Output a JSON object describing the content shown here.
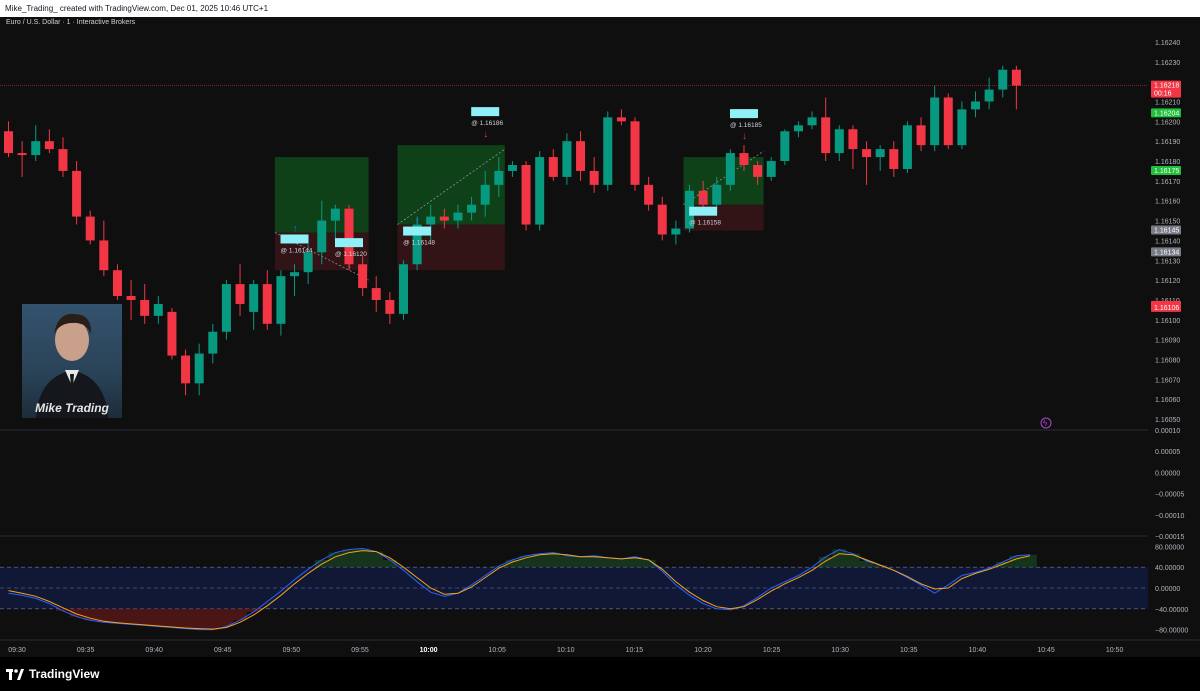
{
  "header": {
    "attribution": "Mike_Trading_ created with TradingView.com, Dec 01, 2025 10:46 UTC+1"
  },
  "symbol_title": "Euro / U.S. Dollar · 1 · Interactive Brokers",
  "overlay": {
    "caption": "Mike Trading"
  },
  "footer": {
    "brand": "TradingView"
  },
  "colors": {
    "up": "#089981",
    "down": "#f23645",
    "background": "#0f0f0f",
    "label_cyan": "#8ff0f8"
  },
  "chart_data": [
    {
      "type": "candlestick",
      "price_axis": {
        "ticks": [
          "1.16240",
          "1.16230",
          "1.16210",
          "1.16200",
          "1.16190",
          "1.16180",
          "1.16170",
          "1.16160",
          "1.16150",
          "1.16140",
          "1.16130",
          "1.16120",
          "1.16110",
          "1.16100",
          "1.16090",
          "1.16080",
          "1.16070",
          "1.16060",
          "1.16050"
        ],
        "badges": [
          {
            "text": "1.16218",
            "sub": "00:16",
            "color": "#f23645",
            "value": 1.16218
          },
          {
            "text": "1.16204",
            "color": "#1fbf3a",
            "value": 1.16204
          },
          {
            "text": "1.16175",
            "color": "#1fbf3a",
            "value": 1.16175
          },
          {
            "text": "1.16145",
            "color": "#787b86",
            "value": 1.16145
          },
          {
            "text": "1.16134",
            "color": "#787b86",
            "value": 1.16134
          },
          {
            "text": "1.16107",
            "color": "#f23645",
            "value": 1.16107
          },
          {
            "text": "1.16106",
            "color": "#f23645",
            "value": 1.16106
          }
        ]
      },
      "time_axis": [
        "09:30",
        "09:35",
        "09:40",
        "09:45",
        "09:50",
        "09:55",
        "10:00",
        "10:05",
        "10:10",
        "10:15",
        "10:20",
        "10:25",
        "10:30",
        "10:35",
        "10:40",
        "10:45",
        "10:50"
      ],
      "candles": [
        [
          1.16195,
          1.162,
          1.16182,
          1.16184
        ],
        [
          1.16184,
          1.1619,
          1.16172,
          1.16183
        ],
        [
          1.16183,
          1.16198,
          1.1618,
          1.1619
        ],
        [
          1.1619,
          1.16196,
          1.16184,
          1.16186
        ],
        [
          1.16186,
          1.16192,
          1.16172,
          1.16175
        ],
        [
          1.16175,
          1.1618,
          1.16148,
          1.16152
        ],
        [
          1.16152,
          1.16155,
          1.16138,
          1.1614
        ],
        [
          1.1614,
          1.1615,
          1.16122,
          1.16125
        ],
        [
          1.16125,
          1.16128,
          1.1611,
          1.16112
        ],
        [
          1.16112,
          1.1612,
          1.161,
          1.1611
        ],
        [
          1.1611,
          1.16118,
          1.16098,
          1.16102
        ],
        [
          1.16102,
          1.16112,
          1.16098,
          1.16108
        ],
        [
          1.16104,
          1.16106,
          1.1608,
          1.16082
        ],
        [
          1.16082,
          1.16085,
          1.16062,
          1.16068
        ],
        [
          1.16068,
          1.16088,
          1.16062,
          1.16083
        ],
        [
          1.16083,
          1.16098,
          1.16078,
          1.16094
        ],
        [
          1.16094,
          1.1612,
          1.1609,
          1.16118
        ],
        [
          1.16118,
          1.16128,
          1.16102,
          1.16108
        ],
        [
          1.16104,
          1.1612,
          1.16095,
          1.16118
        ],
        [
          1.16118,
          1.16125,
          1.16095,
          1.16098
        ],
        [
          1.16098,
          1.16125,
          1.16092,
          1.16122
        ],
        [
          1.16122,
          1.16128,
          1.16112,
          1.16124
        ],
        [
          1.16124,
          1.16138,
          1.16118,
          1.16134
        ],
        [
          1.16134,
          1.1616,
          1.16128,
          1.1615
        ],
        [
          1.1615,
          1.16158,
          1.1614,
          1.16156
        ],
        [
          1.16156,
          1.16158,
          1.16125,
          1.16128
        ],
        [
          1.16128,
          1.16132,
          1.16112,
          1.16116
        ],
        [
          1.16116,
          1.16122,
          1.16104,
          1.1611
        ],
        [
          1.1611,
          1.16114,
          1.16098,
          1.16103
        ],
        [
          1.16103,
          1.1613,
          1.161,
          1.16128
        ],
        [
          1.16128,
          1.16152,
          1.16125,
          1.16148
        ],
        [
          1.16148,
          1.16158,
          1.1614,
          1.16152
        ],
        [
          1.16152,
          1.16156,
          1.16146,
          1.1615
        ],
        [
          1.1615,
          1.16158,
          1.16146,
          1.16154
        ],
        [
          1.16154,
          1.16162,
          1.1615,
          1.16158
        ],
        [
          1.16158,
          1.16175,
          1.16152,
          1.16168
        ],
        [
          1.16168,
          1.16182,
          1.16162,
          1.16175
        ],
        [
          1.16175,
          1.1618,
          1.16172,
          1.16178
        ],
        [
          1.16178,
          1.1618,
          1.16145,
          1.16148
        ],
        [
          1.16148,
          1.16185,
          1.16145,
          1.16182
        ],
        [
          1.16182,
          1.16186,
          1.1617,
          1.16172
        ],
        [
          1.16172,
          1.16194,
          1.16168,
          1.1619
        ],
        [
          1.1619,
          1.16195,
          1.1617,
          1.16175
        ],
        [
          1.16175,
          1.16182,
          1.16164,
          1.16168
        ],
        [
          1.16168,
          1.16205,
          1.16165,
          1.16202
        ],
        [
          1.16202,
          1.16206,
          1.16198,
          1.162
        ],
        [
          1.162,
          1.16202,
          1.16165,
          1.16168
        ],
        [
          1.16168,
          1.16172,
          1.16155,
          1.16158
        ],
        [
          1.16158,
          1.16162,
          1.1614,
          1.16143
        ],
        [
          1.16143,
          1.1615,
          1.16138,
          1.16146
        ],
        [
          1.16146,
          1.16168,
          1.16144,
          1.16165
        ],
        [
          1.16165,
          1.1617,
          1.16155,
          1.16158
        ],
        [
          1.16158,
          1.16172,
          1.16156,
          1.16168
        ],
        [
          1.16168,
          1.16186,
          1.16165,
          1.16184
        ],
        [
          1.16184,
          1.16188,
          1.16175,
          1.16178
        ],
        [
          1.16178,
          1.1618,
          1.16168,
          1.16172
        ],
        [
          1.16172,
          1.16182,
          1.1617,
          1.1618
        ],
        [
          1.1618,
          1.16196,
          1.16178,
          1.16195
        ],
        [
          1.16195,
          1.162,
          1.16192,
          1.16198
        ],
        [
          1.16198,
          1.16205,
          1.16196,
          1.16202
        ],
        [
          1.16202,
          1.16212,
          1.1618,
          1.16184
        ],
        [
          1.16184,
          1.16198,
          1.1618,
          1.16196
        ],
        [
          1.16196,
          1.16198,
          1.16176,
          1.16186
        ],
        [
          1.16186,
          1.1619,
          1.16168,
          1.16182
        ],
        [
          1.16182,
          1.16188,
          1.16175,
          1.16186
        ],
        [
          1.16186,
          1.1619,
          1.16172,
          1.16176
        ],
        [
          1.16176,
          1.162,
          1.16174,
          1.16198
        ],
        [
          1.16198,
          1.16202,
          1.16185,
          1.16188
        ],
        [
          1.16188,
          1.16218,
          1.16185,
          1.16212
        ],
        [
          1.16212,
          1.16214,
          1.16186,
          1.16188
        ],
        [
          1.16188,
          1.1621,
          1.16186,
          1.16206
        ],
        [
          1.16206,
          1.16215,
          1.16202,
          1.1621
        ],
        [
          1.1621,
          1.16222,
          1.16206,
          1.16216
        ],
        [
          1.16216,
          1.16228,
          1.16212,
          1.16226
        ],
        [
          1.16226,
          1.16228,
          1.16206,
          1.16218
        ]
      ],
      "trades": [
        {
          "entry_label": "@ 1.16144",
          "exit_label": "@ 1.16120",
          "entry_value": 1.16144,
          "exit_value": 1.1612,
          "start_bar": 20,
          "end_bar": 26,
          "tp": 1.16182,
          "stop": 1.16125
        },
        {
          "entry_label": "@ 1.16148",
          "exit_label": "@ 1.16186",
          "entry_value": 1.16148,
          "exit_value": 1.16186,
          "start_bar": 29,
          "end_bar": 36,
          "tp": 1.16188,
          "stop": 1.16125
        },
        {
          "entry_label": "@ 1.16158",
          "exit_label": "@ 1.16185",
          "entry_value": 1.16158,
          "exit_value": 1.16185,
          "start_bar": 50,
          "end_bar": 55,
          "tp": 1.16182,
          "stop": 1.16145
        }
      ]
    },
    {
      "type": "line",
      "panel": "oscillator",
      "ticks": [
        "0.00010",
        "0.00005",
        "0.00000",
        "−0.00005",
        "−0.00010",
        "−0.00015"
      ],
      "ylim": [
        -0.00015,
        0.0001
      ]
    },
    {
      "type": "line",
      "panel": "stochastic",
      "ticks": [
        "80.00000",
        "40.00000",
        "0.00000",
        "−40.00000",
        "−80.00000"
      ],
      "ylim": [
        -100,
        100
      ],
      "bands": [
        40,
        0,
        -40
      ],
      "series": [
        {
          "color": "#2962ff",
          "values": [
            -10,
            -14,
            -20,
            -30,
            -44,
            -55,
            -62,
            -66,
            -68,
            -70,
            -72,
            -74,
            -76,
            -78,
            -80,
            -80,
            -74,
            -62,
            -46,
            -26,
            -6,
            16,
            36,
            54,
            68,
            74,
            76,
            70,
            54,
            34,
            12,
            -8,
            -16,
            -10,
            6,
            24,
            42,
            54,
            62,
            66,
            68,
            62,
            60,
            62,
            58,
            56,
            60,
            54,
            32,
            6,
            -14,
            -30,
            -40,
            -42,
            -34,
            -18,
            0,
            12,
            24,
            40,
            60,
            74,
            66,
            52,
            44,
            34,
            20,
            6,
            -10,
            6,
            24,
            30,
            38,
            50,
            62,
            64
          ]
        },
        {
          "color": "#f7a21b",
          "values": [
            -5,
            -10,
            -16,
            -26,
            -38,
            -50,
            -58,
            -64,
            -67,
            -69,
            -71,
            -73,
            -75,
            -77,
            -78,
            -79,
            -76,
            -66,
            -52,
            -34,
            -14,
            8,
            28,
            46,
            60,
            68,
            72,
            70,
            58,
            40,
            20,
            0,
            -12,
            -10,
            2,
            20,
            38,
            50,
            58,
            64,
            66,
            64,
            60,
            60,
            58,
            56,
            58,
            54,
            36,
            12,
            -8,
            -24,
            -36,
            -40,
            -36,
            -22,
            -6,
            8,
            20,
            34,
            52,
            66,
            64,
            54,
            44,
            34,
            22,
            8,
            -2,
            0,
            18,
            28,
            36,
            46,
            56,
            62
          ]
        }
      ]
    }
  ]
}
